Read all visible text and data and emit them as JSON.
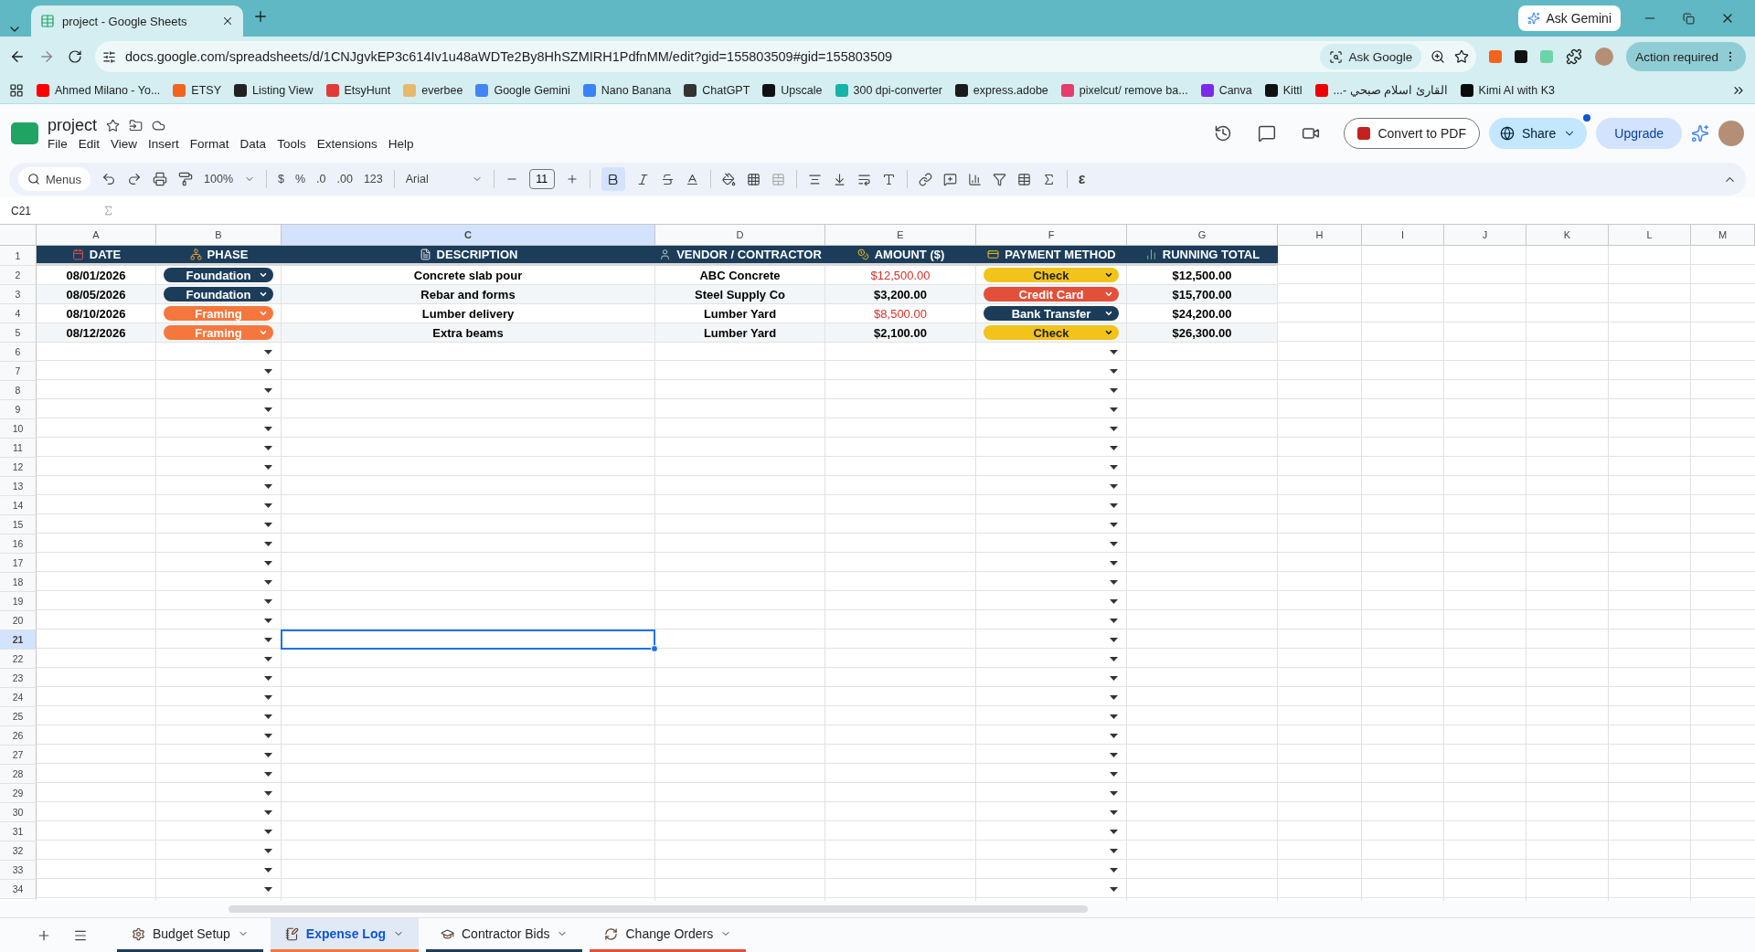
{
  "browser": {
    "tabs": [
      {
        "title": "project - Google Sheets",
        "selected": true
      }
    ],
    "ask_gemini": "Ask Gemini",
    "url": "docs.google.com/spreadsheets/d/1CNJgvkEP3c614Iv1u48aWDTe2By8HhSZMIRH1PdfnMM/edit?gid=155803509#gid=155803509",
    "ask_google": "Ask Google",
    "action_required": "Action required",
    "bookmarks": [
      {
        "label": "Ahmed Milano - Yo...",
        "color": "#ff0000"
      },
      {
        "label": "ETSY",
        "color": "#f1641e"
      },
      {
        "label": "Listing View",
        "color": "#222222"
      },
      {
        "label": "EtsyHunt",
        "color": "#e03a3a"
      },
      {
        "label": "everbee",
        "color": "#e8b86b"
      },
      {
        "label": "Google Gemini",
        "color": "#4285f4"
      },
      {
        "label": "Nano Banana",
        "color": "#3b82f6"
      },
      {
        "label": "ChatGPT",
        "color": "#333333"
      },
      {
        "label": "Upscale",
        "color": "#111111"
      },
      {
        "label": "300 dpi-converter",
        "color": "#13b5a6"
      },
      {
        "label": "express.adobe",
        "color": "#1a1a1a"
      },
      {
        "label": "pixelcut/ remove ba...",
        "color": "#e53e6b"
      },
      {
        "label": "Canva",
        "color": "#7d2ae8"
      },
      {
        "label": "Kittl",
        "color": "#101010"
      },
      {
        "label": "القارئ اسلام صبحي -...",
        "color": "#ee0000"
      },
      {
        "label": "Kimi AI with K3",
        "color": "#0a0a0a"
      }
    ]
  },
  "doc": {
    "title": "project",
    "menu": [
      "File",
      "Edit",
      "View",
      "Insert",
      "Format",
      "Data",
      "Tools",
      "Extensions",
      "Help"
    ],
    "convert": "Convert to PDF",
    "share": "Share",
    "upgrade": "Upgrade"
  },
  "toolbar": {
    "search": "Menus",
    "zoom": "100%",
    "currency": "$",
    "percent": "%",
    "dec_decrease": ".0",
    "dec_increase": ".00",
    "number_format": "123",
    "font": "Arial",
    "font_size": "11",
    "bold_selected": true,
    "epsilon": "ε"
  },
  "formula_bar": {
    "cell_ref": "C21"
  },
  "sheet": {
    "columns": [
      {
        "letter": "A",
        "selected": false
      },
      {
        "letter": "B",
        "selected": false
      },
      {
        "letter": "C",
        "selected": true
      },
      {
        "letter": "D",
        "selected": false
      },
      {
        "letter": "E",
        "selected": false
      },
      {
        "letter": "F",
        "selected": false
      },
      {
        "letter": "G",
        "selected": false
      },
      {
        "letter": "H",
        "selected": false
      },
      {
        "letter": "I",
        "selected": false
      },
      {
        "letter": "J",
        "selected": false
      },
      {
        "letter": "K",
        "selected": false
      },
      {
        "letter": "L",
        "selected": false
      },
      {
        "letter": "M",
        "selected": false
      }
    ],
    "header_number": "1",
    "header": [
      "DATE",
      "PHASE",
      "DESCRIPTION",
      "VENDOR / CONTRACTOR",
      "AMOUNT ($)",
      "PAYMENT METHOD",
      "RUNNING TOTAL"
    ],
    "data_rows": [
      {
        "number": "2",
        "date": "08/01/2026",
        "phase": {
          "label": "Foundation",
          "color": "#1c3d5a"
        },
        "description": "Concrete slab pour",
        "vendor": "ABC Concrete",
        "amount": {
          "text": "$12,500.00",
          "color": "#d93025"
        },
        "payment": {
          "label": "Check",
          "color": "#f2c31b"
        },
        "running_total": "$12,500.00"
      },
      {
        "number": "3",
        "date": "08/05/2026",
        "phase": {
          "label": "Foundation",
          "color": "#1c3d5a"
        },
        "description": "Rebar and forms",
        "vendor": "Steel Supply Co",
        "amount": {
          "text": "$3,200.00",
          "color": "#000000"
        },
        "payment": {
          "label": "Credit Card",
          "color": "#e2503a"
        },
        "running_total": "$15,700.00"
      },
      {
        "number": "4",
        "date": "08/10/2026",
        "phase": {
          "label": "Framing",
          "color": "#f5773d"
        },
        "description": "Lumber delivery",
        "vendor": "Lumber Yard",
        "amount": {
          "text": "$8,500.00",
          "color": "#d93025"
        },
        "payment": {
          "label": "Bank Transfer",
          "color": "#1c3d5a"
        },
        "running_total": "$24,200.00"
      },
      {
        "number": "5",
        "date": "08/12/2026",
        "phase": {
          "label": "Framing",
          "color": "#f5773d"
        },
        "description": "Extra beams",
        "vendor": "Lumber Yard",
        "amount": {
          "text": "$2,100.00",
          "color": "#000000"
        },
        "payment": {
          "label": "Check",
          "color": "#f2c31b"
        },
        "running_total": "$26,300.00"
      }
    ],
    "empty_rows": [
      {
        "number": "6",
        "selected": false
      },
      {
        "number": "7",
        "selected": false
      },
      {
        "number": "8",
        "selected": false
      },
      {
        "number": "9",
        "selected": false
      },
      {
        "number": "10",
        "selected": false
      },
      {
        "number": "11",
        "selected": false
      },
      {
        "number": "12",
        "selected": false
      },
      {
        "number": "13",
        "selected": false
      },
      {
        "number": "14",
        "selected": false
      },
      {
        "number": "15",
        "selected": false
      },
      {
        "number": "16",
        "selected": false
      },
      {
        "number": "17",
        "selected": false
      },
      {
        "number": "18",
        "selected": false
      },
      {
        "number": "19",
        "selected": false
      },
      {
        "number": "20",
        "selected": false
      },
      {
        "number": "21",
        "selected": true
      },
      {
        "number": "22",
        "selected": false
      },
      {
        "number": "23",
        "selected": false
      },
      {
        "number": "24",
        "selected": false
      },
      {
        "number": "25",
        "selected": false
      },
      {
        "number": "26",
        "selected": false
      },
      {
        "number": "27",
        "selected": false
      },
      {
        "number": "28",
        "selected": false
      },
      {
        "number": "29",
        "selected": false
      },
      {
        "number": "30",
        "selected": false
      },
      {
        "number": "31",
        "selected": false
      },
      {
        "number": "32",
        "selected": false
      },
      {
        "number": "33",
        "selected": false
      },
      {
        "number": "34",
        "selected": false
      }
    ]
  },
  "sheet_tabs": [
    {
      "label": "Budget Setup",
      "selected": false,
      "color": "#1c3d5a"
    },
    {
      "label": "Expense Log",
      "selected": true,
      "color": "#f5773d"
    },
    {
      "label": "Contractor Bids",
      "selected": false,
      "color": "#1c3d5a"
    },
    {
      "label": "Change Orders",
      "selected": false,
      "color": "#e2503a"
    }
  ]
}
